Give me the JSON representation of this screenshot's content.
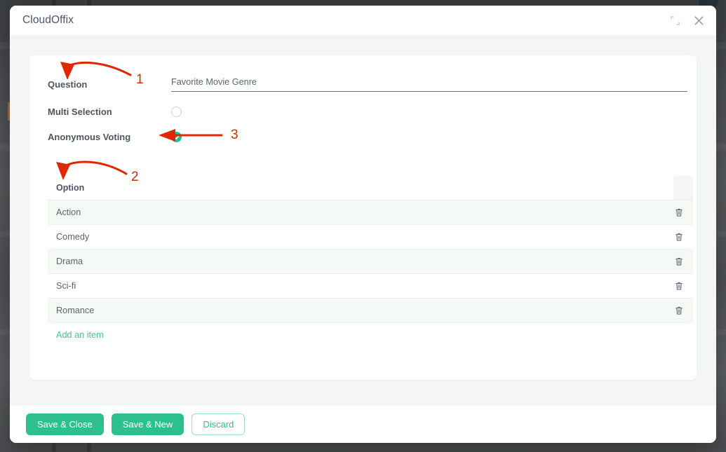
{
  "window": {
    "title": "CloudOffix",
    "restore_icon": "restore-window-icon",
    "close_icon": "close-icon"
  },
  "form": {
    "question": {
      "label": "Question",
      "value": "Favorite Movie Genre",
      "placeholder": ""
    },
    "multi_selection": {
      "label": "Multi Selection",
      "checked": false
    },
    "anonymous_voting": {
      "label": "Anonymous Voting",
      "checked": true
    }
  },
  "options_table": {
    "header": "Option",
    "rows": [
      {
        "option": "Action"
      },
      {
        "option": "Comedy"
      },
      {
        "option": "Drama"
      },
      {
        "option": "Sci-fi"
      },
      {
        "option": "Romance"
      }
    ],
    "add_item_label": "Add an item",
    "delete_icon": "trash-icon"
  },
  "footer": {
    "save_close_label": "Save & Close",
    "save_new_label": "Save & New",
    "discard_label": "Discard"
  },
  "annotations": [
    {
      "number": "1"
    },
    {
      "number": "2"
    },
    {
      "number": "3"
    }
  ],
  "colors": {
    "accent_green": "#2ec08c",
    "link_green": "#3ec79a",
    "annotation_red": "#e02800",
    "label_text": "#4b5563",
    "value_text": "#5a6472",
    "row_alt": "#f4f9f6",
    "body_bg": "#f4f5f6"
  }
}
